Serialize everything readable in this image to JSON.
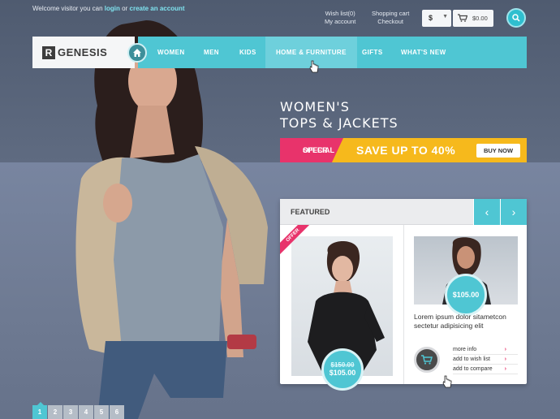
{
  "header": {
    "welcome_prefix": "Welcome visitor you can",
    "login": "login",
    "or": "or",
    "create_account": "create an account",
    "wishlist": "Wish list(0)",
    "my_account": "My account",
    "shopping_cart": "Shopping cart",
    "checkout": "Checkout",
    "currency": "$",
    "cart_amount": "$0.00"
  },
  "logo": {
    "mark": "R",
    "text": "GENESIS"
  },
  "nav": {
    "items": [
      "WOMEN",
      "MEN",
      "KIDS",
      "HOME & FURNITURE",
      "GIFTS",
      "WHAT'S NEW"
    ],
    "active_index": 3
  },
  "hero": {
    "title_line1": "WOMEN'S",
    "title_line2": "TOPS & JACKETS",
    "special_line1": "SPECIAL",
    "special_line2": "OFFER",
    "save_text": "SAVE UP TO 40%",
    "buy_now": "BUY NOW"
  },
  "featured": {
    "title": "FEATURED",
    "prev": "‹",
    "next": "›",
    "product1": {
      "ribbon": "OFFER",
      "old_price": "$150.00",
      "price": "$105.00"
    },
    "product2": {
      "price": "$105.00",
      "description": "Lorem ipsum dolor sitametcon sectetur adipisicing elit",
      "more_info": "more info",
      "add_wishlist": "add to wish list",
      "add_compare": "add to compare"
    }
  },
  "pagination": {
    "pages": [
      "1",
      "2",
      "3",
      "4",
      "5",
      "6"
    ],
    "active_index": 0
  },
  "colors": {
    "accent": "#4fc6d3",
    "pink": "#e8336b",
    "yellow": "#f6b91c"
  }
}
